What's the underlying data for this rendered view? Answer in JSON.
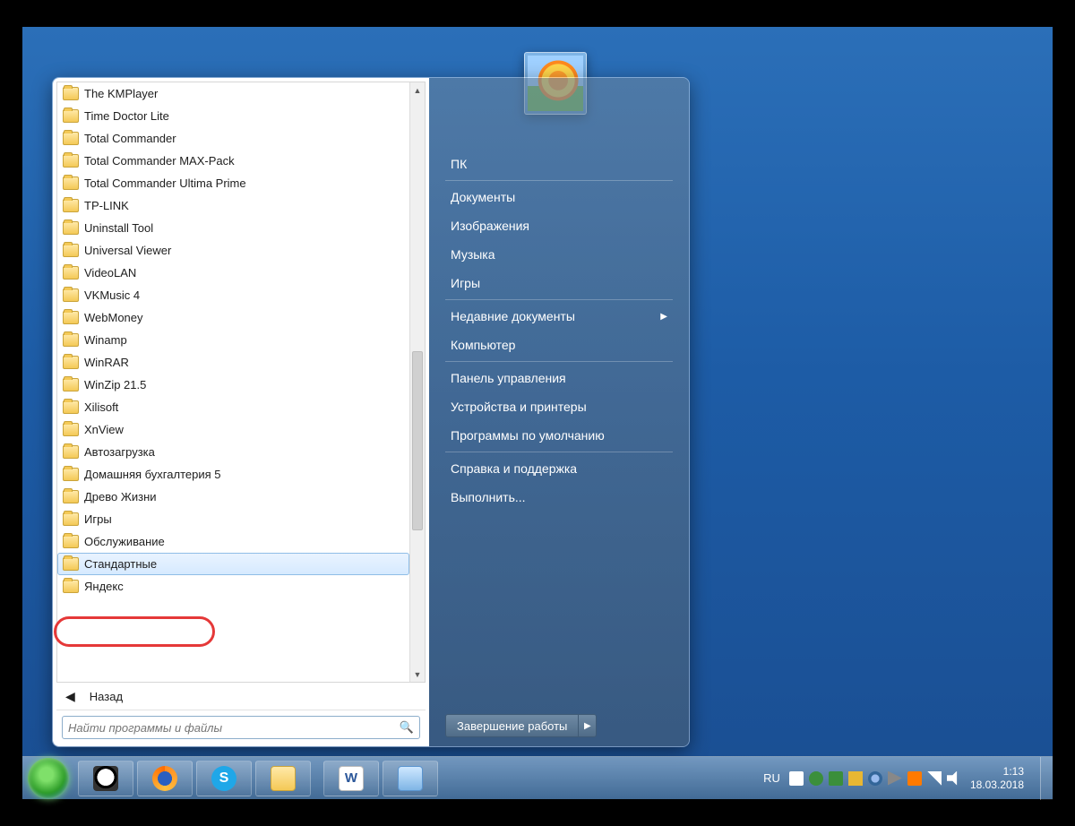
{
  "programs": [
    "The KMPlayer",
    "Time Doctor Lite",
    "Total Commander",
    "Total Commander MAX-Pack",
    "Total Commander Ultima Prime",
    "TP-LINK",
    "Uninstall Tool",
    "Universal Viewer",
    "VideoLAN",
    "VKMusic 4",
    "WebMoney",
    "Winamp",
    "WinRAR",
    "WinZip 21.5",
    "Xilisoft",
    "XnView",
    "Автозагрузка",
    "Домашняя бухгалтерия 5",
    "Древо Жизни",
    "Игры",
    "Обслуживание",
    "Стандартные",
    "Яндекс"
  ],
  "selected_index": 21,
  "back_label": "Назад",
  "search_placeholder": "Найти программы и файлы",
  "right_menu": {
    "items": [
      "ПК",
      "Документы",
      "Изображения",
      "Музыка",
      "Игры",
      "Недавние документы",
      "Компьютер",
      "Панель управления",
      "Устройства и принтеры",
      "Программы по умолчанию",
      "Справка и поддержка",
      "Выполнить..."
    ],
    "submenu_index": 5
  },
  "shutdown_label": "Завершение работы",
  "tray": {
    "lang": "RU",
    "time": "1:13",
    "date": "18.03.2018"
  }
}
